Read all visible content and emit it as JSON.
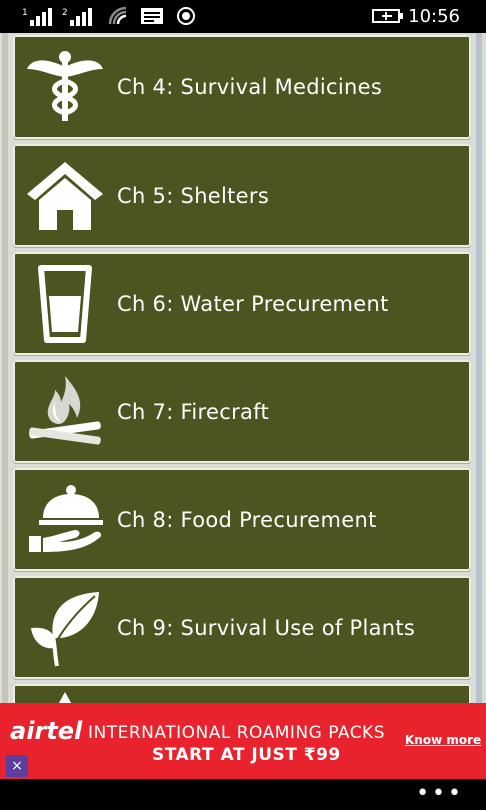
{
  "statusbar": {
    "time": "10:56",
    "sim1": "1",
    "sim2": "2"
  },
  "chapters": [
    {
      "label": "Ch 4: Survival Medicines",
      "icon": "caduceus-icon"
    },
    {
      "label": "Ch 5: Shelters",
      "icon": "house-icon"
    },
    {
      "label": "Ch 6: Water Precurement",
      "icon": "water-glass-icon"
    },
    {
      "label": "Ch 7: Firecraft",
      "icon": "campfire-icon"
    },
    {
      "label": "Ch 8: Food Precurement",
      "icon": "food-cloche-icon"
    },
    {
      "label": "Ch 9: Survival Use of Plants",
      "icon": "leaf-icon"
    }
  ],
  "ad": {
    "brand": "airtel",
    "headline": "INTERNATIONAL ROAMING PACKS",
    "subline": "START AT JUST ₹99",
    "cta": "Know more",
    "close": "×"
  },
  "appbar": {
    "more": "•••"
  },
  "colors": {
    "card": "#4c541f",
    "background": "#d9ddd5",
    "ad": "#e8232d"
  }
}
